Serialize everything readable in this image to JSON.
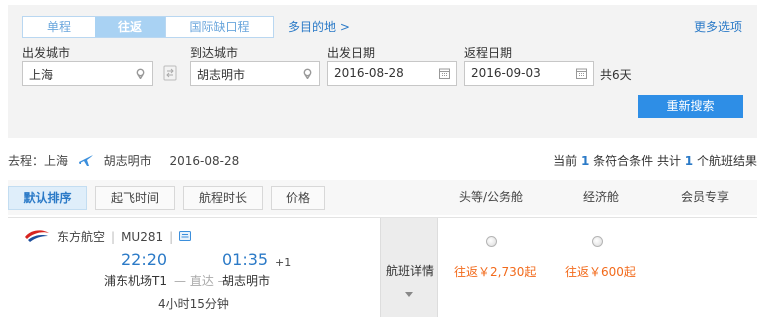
{
  "search": {
    "trip_tabs": [
      "单程",
      "往返",
      "国际缺口程"
    ],
    "multi_city_link": "多目的地 >",
    "more_options": "更多选项",
    "labels": {
      "depart_city": "出发城市",
      "arrive_city": "到达城市",
      "depart_date": "出发日期",
      "return_date": "返程日期"
    },
    "values": {
      "depart_city": "上海",
      "arrive_city": "胡志明市",
      "depart_date": "2016-08-28",
      "return_date": "2016-09-03"
    },
    "trip_days": "共6天",
    "research_button": "重新搜索"
  },
  "route": {
    "prefix": "去程：上海",
    "to_city": "胡志明市",
    "date": "2016-08-28",
    "count_pre": "当前",
    "count_match": "1",
    "count_mid": "条符合条件 共计",
    "count_total": "1",
    "count_post": "个航班结果"
  },
  "sort": {
    "buttons": [
      "默认排序",
      "起飞时间",
      "航程时长",
      "价格"
    ],
    "columns": [
      "头等/公务舱",
      "经济舱",
      "会员专享"
    ]
  },
  "flight": {
    "airline": "东方航空",
    "flight_no": "MU281",
    "dep_time": "22:20",
    "arr_time": "01:35",
    "day_offset": "+1",
    "dep_airport": "浦东机场T1",
    "direct": "直达",
    "arr_airport": "胡志明市",
    "duration": "4小时15分钟",
    "detail_label": "航班详情",
    "price_business": "往返￥2,730起",
    "price_economy": "往返￥600起"
  },
  "colors": {
    "accent": "#2e8ee6",
    "price": "#f26a1b",
    "link": "#2b7ac7"
  }
}
